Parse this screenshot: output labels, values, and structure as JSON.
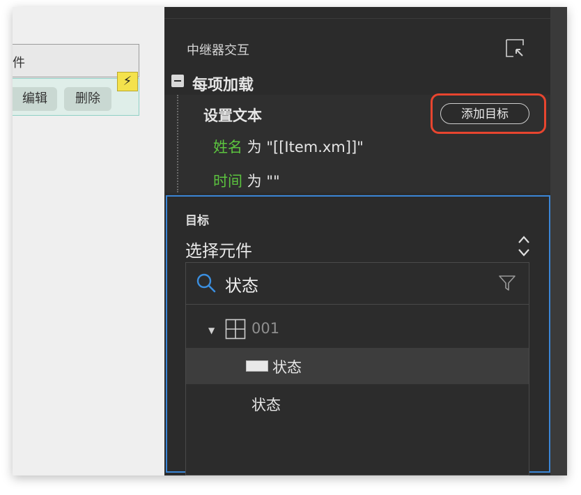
{
  "canvas": {
    "header_text": "件",
    "edit_label": "编辑",
    "delete_label": "删除",
    "bolt_symbol": "⚡"
  },
  "panel": {
    "section_title": "中继器交互",
    "event_name": "每项加载",
    "action_name": "设置文本",
    "add_target_label": "添加目标",
    "assignments": [
      {
        "key": "姓名",
        "op": " 为 ",
        "value": "\"[[Item.xm]]\""
      },
      {
        "key": "时间",
        "op": " 为 ",
        "value": "\"\""
      }
    ],
    "target": {
      "label": "目标",
      "select_label": "选择元件",
      "search_value": "状态",
      "tree": [
        {
          "label": "001"
        },
        {
          "label": "状态"
        },
        {
          "label": "状态"
        }
      ]
    }
  },
  "colors": {
    "panel_bg": "#2b2b2b",
    "highlight_red": "#e8452f",
    "focus_blue": "#3b86d6",
    "key_green": "#5cc43f"
  }
}
